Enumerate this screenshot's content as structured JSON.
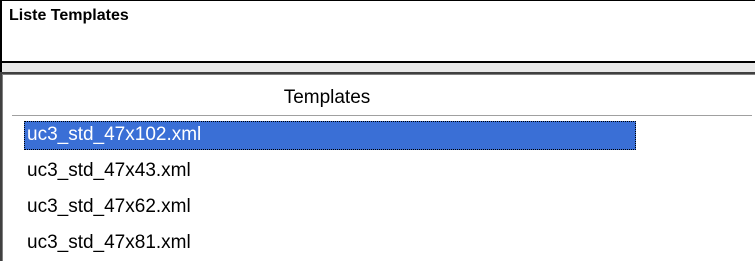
{
  "panel": {
    "title": "Liste Templates"
  },
  "list": {
    "column_header": "Templates",
    "selected_index": 0,
    "items": [
      "uc3_std_47x102.xml",
      "uc3_std_47x43.xml",
      "uc3_std_47x62.xml",
      "uc3_std_47x81.xml"
    ]
  },
  "colors": {
    "selection_bg": "#3a6fd6",
    "selection_fg": "#ffffff"
  }
}
